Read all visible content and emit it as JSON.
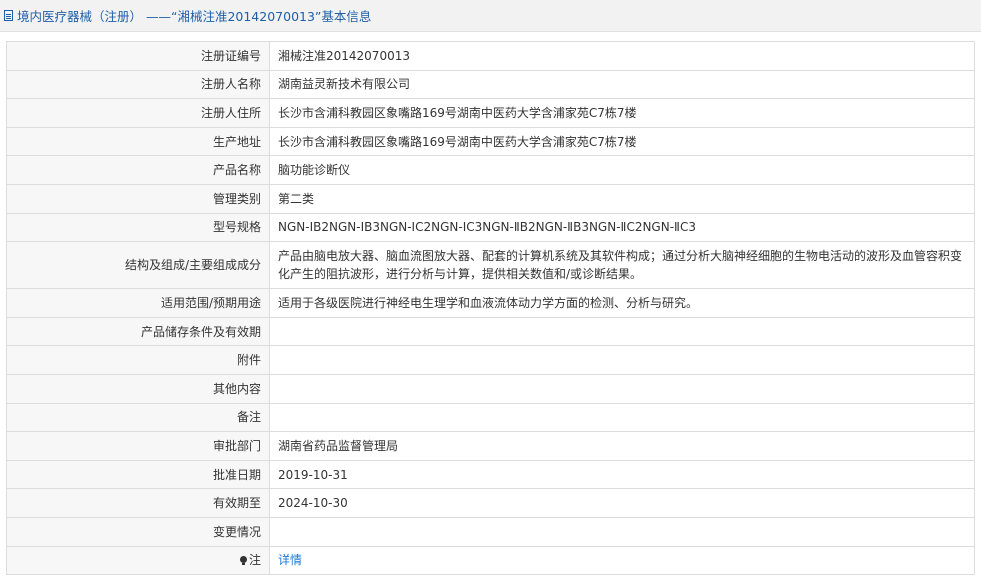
{
  "header": {
    "title": "境内医疗器械（注册） ——“湘械注准20142070013”基本信息"
  },
  "rows": [
    {
      "label": "注册证编号",
      "value": "湘械注准20142070013"
    },
    {
      "label": "注册人名称",
      "value": "湖南益灵新技术有限公司"
    },
    {
      "label": "注册人住所",
      "value": "长沙市含浦科教园区象嘴路169号湖南中医药大学含浦家苑C7栋7楼"
    },
    {
      "label": "生产地址",
      "value": "长沙市含浦科教园区象嘴路169号湖南中医药大学含浦家苑C7栋7楼"
    },
    {
      "label": "产品名称",
      "value": "脑功能诊断仪"
    },
    {
      "label": "管理类别",
      "value": "第二类"
    },
    {
      "label": "型号规格",
      "value": "NGN-IB2NGN-IB3NGN-IC2NGN-IC3NGN-ⅡB2NGN-ⅡB3NGN-ⅡC2NGN-ⅡC3"
    },
    {
      "label": "结构及组成/主要组成成分",
      "value": "产品由脑电放大器、脑血流图放大器、配套的计算机系统及其软件构成；通过分析大脑神经细胞的生物电活动的波形及血管容积变化产生的阻抗波形，进行分析与计算，提供相关数值和/或诊断结果。"
    },
    {
      "label": "适用范围/预期用途",
      "value": "适用于各级医院进行神经电生理学和血液流体动力学方面的检测、分析与研究。"
    },
    {
      "label": "产品储存条件及有效期",
      "value": ""
    },
    {
      "label": "附件",
      "value": ""
    },
    {
      "label": "其他内容",
      "value": ""
    },
    {
      "label": "备注",
      "value": ""
    },
    {
      "label": "审批部门",
      "value": "湖南省药品监督管理局"
    },
    {
      "label": "批准日期",
      "value": "2019-10-31"
    },
    {
      "label": "有效期至",
      "value": "2024-10-30"
    },
    {
      "label": "变更情况",
      "value": ""
    }
  ],
  "note_row": {
    "label": "注",
    "icon": "lightbulb-icon",
    "link_text": "详情"
  }
}
